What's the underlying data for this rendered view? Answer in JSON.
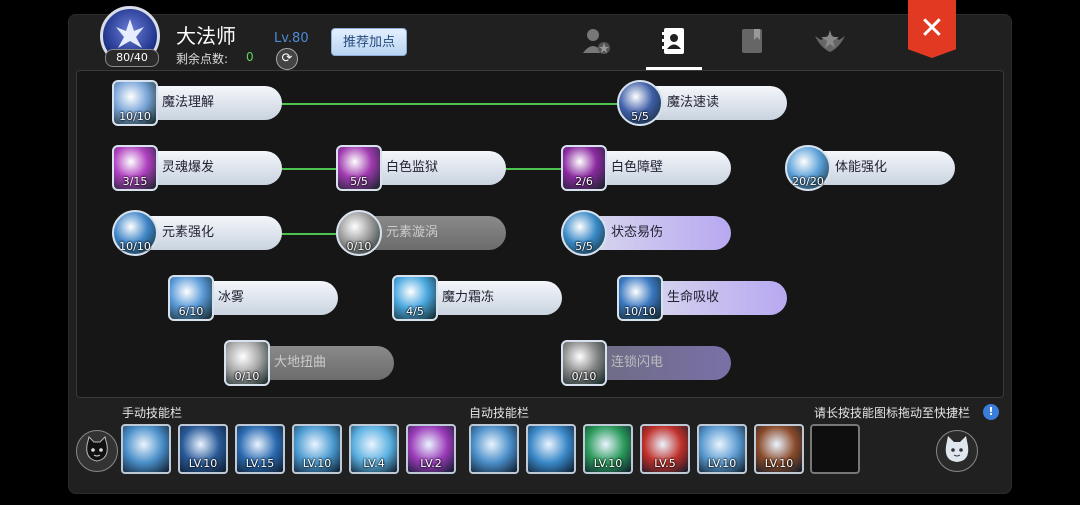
{
  "header": {
    "class_name": "大法师",
    "avatar_points": "80/40",
    "points_label": "剩余点数:",
    "points_value": "0",
    "level": "Lv.80",
    "recommend_label": "推荐加点",
    "tabs": [
      "person-star-icon",
      "contacts-book-icon",
      "book-icon",
      "emblem-icon"
    ]
  },
  "skills": [
    {
      "name": "魔法理解",
      "level": "10/10",
      "style": "normal",
      "color": "#7aa6d8"
    },
    {
      "name": "魔法速读",
      "level": "5/5",
      "style": "normal",
      "color": "#3f5fa8"
    },
    {
      "name": "灵魂爆发",
      "level": "3/15",
      "style": "normal",
      "color": "#b040c0"
    },
    {
      "name": "白色监狱",
      "level": "5/5",
      "style": "normal",
      "color": "#a03ab0"
    },
    {
      "name": "白色障壁",
      "level": "2/6",
      "style": "normal",
      "color": "#8a2aa0"
    },
    {
      "name": "体能强化",
      "level": "20/20",
      "style": "normal",
      "color": "#5aa0d8"
    },
    {
      "name": "元素强化",
      "level": "10/10",
      "style": "normal",
      "color": "#3f86c8"
    },
    {
      "name": "元素漩涡",
      "level": "0/10",
      "style": "locked",
      "color": "#9a9a9a"
    },
    {
      "name": "状态易伤",
      "level": "5/5",
      "style": "purple",
      "color": "#3a8ac8"
    },
    {
      "name": "冰雾",
      "level": "6/10",
      "style": "normal",
      "color": "#5a9ad8"
    },
    {
      "name": "魔力霜冻",
      "level": "4/5",
      "style": "normal",
      "color": "#4aa8e0"
    },
    {
      "name": "生命吸收",
      "level": "10/10",
      "style": "purple",
      "color": "#3a78c0"
    },
    {
      "name": "大地扭曲",
      "level": "0/10",
      "style": "locked",
      "color": "#a8a8a8"
    },
    {
      "name": "连锁闪电",
      "level": "0/10",
      "style": "locked2",
      "color": "#8a8a8a"
    }
  ],
  "manual_bar": {
    "title": "手动技能栏",
    "slots": [
      {
        "level": "",
        "color": "#4a8ec8"
      },
      {
        "level": "LV.10",
        "color": "#2a5a98"
      },
      {
        "level": "LV.15",
        "color": "#2a6ab0"
      },
      {
        "level": "LV.10",
        "color": "#4a9ad0"
      },
      {
        "level": "LV.4",
        "color": "#5ab0e0"
      },
      {
        "level": "LV.2",
        "color": "#9a3ab8"
      }
    ]
  },
  "auto_bar": {
    "title": "自动技能栏",
    "slots": [
      {
        "level": "",
        "color": "#4a8ec8"
      },
      {
        "level": "",
        "color": "#3a88c8"
      },
      {
        "level": "LV.10",
        "color": "#2a9a5a"
      },
      {
        "level": "LV.5",
        "color": "#c0302a"
      },
      {
        "level": "LV.10",
        "color": "#5a9ad0"
      },
      {
        "level": "LV.10",
        "color": "#8a4a2a"
      },
      {
        "level": "",
        "color": ""
      }
    ]
  },
  "hint": "请长按技能图标拖动至快捷栏"
}
